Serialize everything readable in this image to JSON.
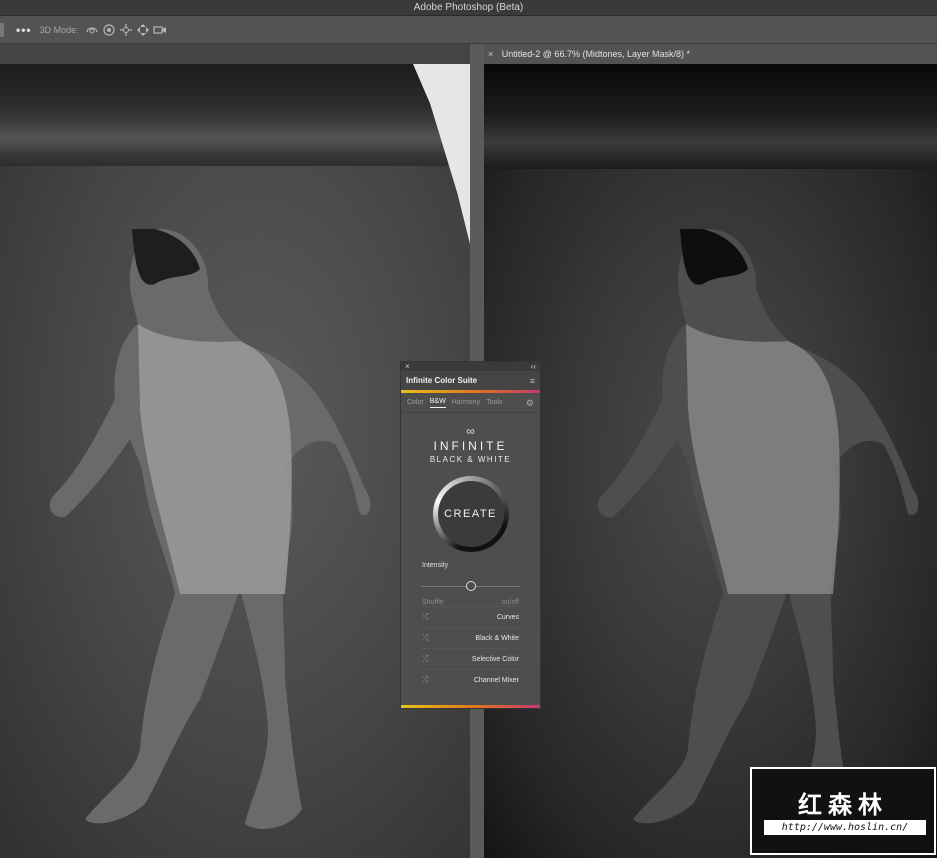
{
  "window": {
    "title": "Adobe Photoshop (Beta)"
  },
  "options_bar": {
    "more_label": "•••",
    "mode_label": "3D Mode:",
    "mode_icons": [
      "orbit-3d-icon",
      "roll-3d-icon",
      "pan-3d-icon",
      "slide-3d-icon",
      "camera-3d-icon"
    ]
  },
  "document": {
    "tab_close": "×",
    "tab_title": "Untitled-2 @ 66.7% (Midtones, Layer Mask/8) *"
  },
  "panel": {
    "close": "×",
    "collapse": "‹‹",
    "title": "Infinite Color Suite",
    "menu_icon": "≡",
    "tabs": [
      "Color",
      "B&W",
      "Harmony",
      "Tools"
    ],
    "active_tab": "B&W",
    "gear_icon": "⚙",
    "logo_symbol": "∞",
    "brand_line1": "INFINITE",
    "brand_line2": "BLACK & WHITE",
    "create_label": "CREATE",
    "intensity_label": "Intensity",
    "intensity_value": 0.5,
    "shuffle_label": "Shuffle",
    "onoff_label": "on/off",
    "options": [
      "Curves",
      "Black & White",
      "Selective Color",
      "Channel Mixer"
    ],
    "shuffle_icon": "⤮",
    "accent_colors": [
      "#e8c31a",
      "#e07a1e",
      "#c23a6e"
    ]
  },
  "watermark": {
    "chinese": "红森林",
    "url": "http://www.hoslin.cn/"
  }
}
